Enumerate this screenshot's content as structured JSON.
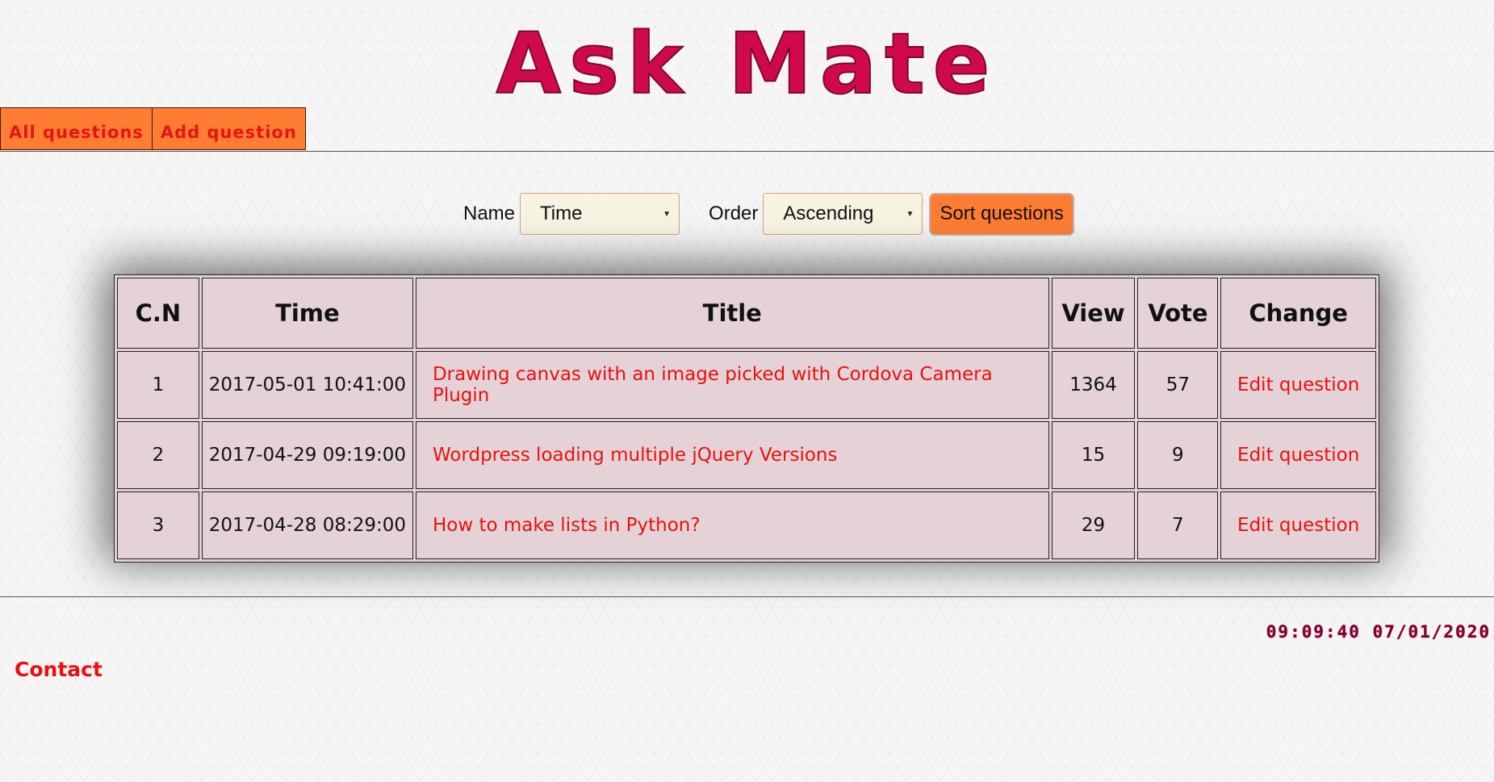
{
  "header": {
    "title": "Ask Mate"
  },
  "nav": {
    "all_questions": "All questions",
    "add_question": "Add question"
  },
  "sort": {
    "name_label": "Name",
    "name_value": "Time",
    "order_label": "Order",
    "order_value": "Ascending",
    "button_label": "Sort questions"
  },
  "table": {
    "headers": [
      "C.N",
      "Time",
      "Title",
      "View",
      "Vote",
      "Change"
    ],
    "rows": [
      {
        "cn": "1",
        "time": "2017-05-01 10:41:00",
        "title": "Drawing canvas with an image picked with Cordova Camera Plugin",
        "view": "1364",
        "vote": "57",
        "change": "Edit question"
      },
      {
        "cn": "2",
        "time": "2017-04-29 09:19:00",
        "title": "Wordpress loading multiple jQuery Versions",
        "view": "15",
        "vote": "9",
        "change": "Edit question"
      },
      {
        "cn": "3",
        "time": "2017-04-28 08:29:00",
        "title": "How to make lists in Python?",
        "view": "29",
        "vote": "7",
        "change": "Edit question"
      }
    ]
  },
  "footer": {
    "clock": "09:09:40 07/01/2020",
    "contact": "Contact"
  },
  "colors": {
    "accent": "#ff7d33",
    "title": "#d00a4a",
    "link": "#e81010",
    "table_bg": "#e4d2d6"
  }
}
